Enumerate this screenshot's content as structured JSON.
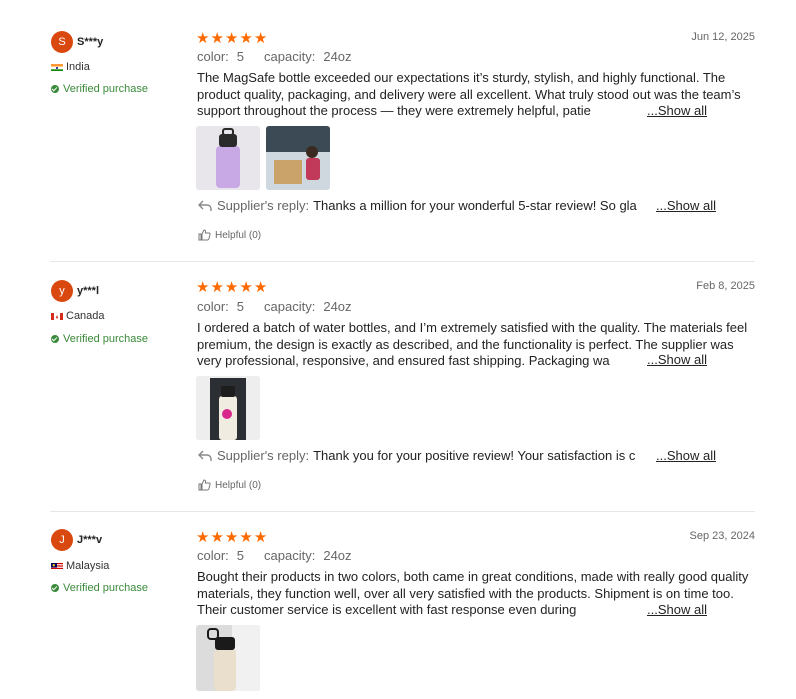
{
  "reviews": [
    {
      "avatar_letter": "S",
      "username": "S***y",
      "country": "India",
      "verified": "Verified purchase",
      "stars": 5,
      "date": "Jun 12, 2025",
      "attr_color_label": "color:",
      "attr_color_value": "5",
      "attr_capacity_label": "capacity:",
      "attr_capacity_value": "24oz",
      "text": "The MagSafe bottle exceeded our expectations it’s sturdy, stylish, and highly functional. The product quality, packaging, and delivery were all excellent. What truly stood out was the team’s support throughout the process — they were extremely helpful, patie",
      "show_all": "...Show all",
      "reply_label": "Supplier's reply:",
      "reply_text": "Thanks a million for your wonderful 5-star review! So gla",
      "reply_show_all": "...Show all",
      "helpful": "Helpful (0)"
    },
    {
      "avatar_letter": "y",
      "username": "y***l",
      "country": "Canada",
      "verified": "Verified purchase",
      "stars": 5,
      "date": "Feb 8, 2025",
      "attr_color_label": "color:",
      "attr_color_value": "5",
      "attr_capacity_label": "capacity:",
      "attr_capacity_value": "24oz",
      "text": "I ordered a batch of water bottles, and I’m extremely satisfied with the quality. The materials feel premium, the design is exactly as described, and the functionality is perfect. The supplier was very professional, responsive, and ensured fast shipping. Packaging wa",
      "show_all": "...Show all",
      "reply_label": "Supplier's reply:",
      "reply_text": "Thank you for your positive review! Your satisfaction is c",
      "reply_show_all": "...Show all",
      "helpful": "Helpful (0)"
    },
    {
      "avatar_letter": "J",
      "username": "J***v",
      "country": "Malaysia",
      "verified": "Verified purchase",
      "stars": 5,
      "date": "Sep 23, 2024",
      "attr_color_label": "color:",
      "attr_color_value": "5",
      "attr_capacity_label": "capacity:",
      "attr_capacity_value": "24oz",
      "text": "Bought their products in two colors, both came in great conditions, made with really good quality materials, they function well, over all very satisfied with the products. Shipment is on time too. Their customer service is excellent with fast response even during",
      "show_all": "...Show all"
    }
  ],
  "colors": {
    "accent": "#ff6a00",
    "avatar": "#d9480f",
    "verified": "#3a8a3a"
  }
}
